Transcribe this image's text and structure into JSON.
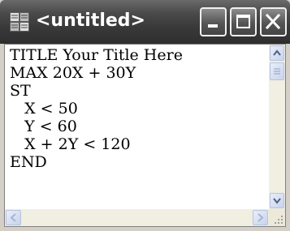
{
  "window": {
    "title": "<untitled>",
    "app_icon": "grid-app-icon",
    "buttons": {
      "minimize": "minimize-icon",
      "maximize": "maximize-icon",
      "close": "close-icon"
    }
  },
  "editor": {
    "lines": [
      "TITLE Your Title Here",
      "MAX 20X + 30Y",
      "ST",
      "   X < 50",
      "   Y < 60",
      "   X + 2Y < 120",
      "END"
    ]
  },
  "scrollbars": {
    "vertical": {
      "up": "arrow-up-icon",
      "down": "arrow-down-icon",
      "thumb": "scroll-thumb"
    },
    "horizontal": {
      "left": "arrow-left-icon",
      "right": "arrow-right-icon"
    },
    "resize_grip": "resize-grip-icon"
  },
  "colors": {
    "titlebar": "#3a3a3a",
    "title_text": "#ffffff",
    "editor_bg": "#ffffff",
    "scroll_track": "#f1efe2",
    "scroll_button": "#c8d3ec"
  }
}
